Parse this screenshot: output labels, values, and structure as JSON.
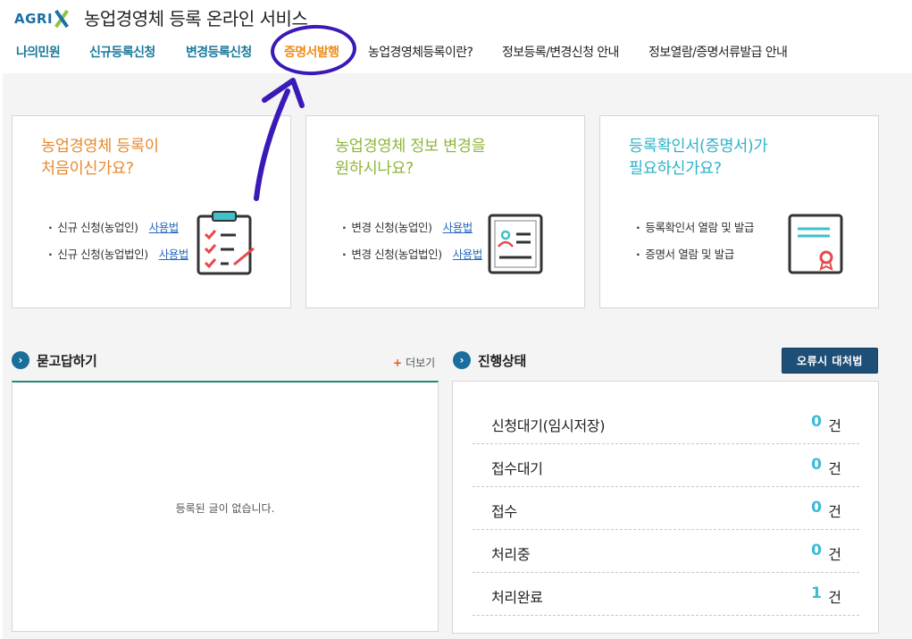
{
  "header": {
    "logo_text": "AGRI",
    "site_title": "농업경영체 등록 온라인 서비스"
  },
  "nav": {
    "items": [
      {
        "label": "나의민원"
      },
      {
        "label": "신규등록신청"
      },
      {
        "label": "변경등록신청"
      },
      {
        "label": "증명서발행"
      },
      {
        "label": "농업경영체등록이란?"
      },
      {
        "label": "정보등록/변경신청 안내"
      },
      {
        "label": "정보열람/증명서류발급 안내"
      }
    ]
  },
  "cards": [
    {
      "title_line1": "농업경영체 등록이",
      "title_line2": "처음이신가요?",
      "title_color": "#e8892c",
      "items": [
        {
          "text": "신규 신청(농업인)",
          "link": "사용법"
        },
        {
          "text": "신규 신청(농업법인)",
          "link": "사용법"
        }
      ],
      "icon": "clipboard-checklist-icon"
    },
    {
      "title_line1": "농업경영체 정보 변경을",
      "title_line2": "원하시나요?",
      "title_color": "#8fb63a",
      "items": [
        {
          "text": "변경 신청(농업인)",
          "link": "사용법"
        },
        {
          "text": "변경 신청(농업법인)",
          "link": "사용법"
        }
      ],
      "icon": "id-card-icon"
    },
    {
      "title_line1": "등록확인서(증명서)가",
      "title_line2": "필요하신가요?",
      "title_color": "#2ab3c8",
      "items": [
        {
          "text": "등록확인서 열람 및 발급"
        },
        {
          "text": "증명서 열람 및 발급"
        }
      ],
      "icon": "certificate-icon"
    }
  ],
  "qna": {
    "title": "묻고답하기",
    "more_label": "더보기",
    "empty_text": "등록된 글이 없습니다."
  },
  "status": {
    "title": "진행상태",
    "error_button": "오류시 대처법",
    "unit": "건",
    "rows": [
      {
        "label": "신청대기(임시저장)",
        "count": "0"
      },
      {
        "label": "접수대기",
        "count": "0"
      },
      {
        "label": "접수",
        "count": "0"
      },
      {
        "label": "처리중",
        "count": "0"
      },
      {
        "label": "처리완료",
        "count": "1"
      }
    ]
  },
  "colors": {
    "accent_teal": "#1a7a9c",
    "accent_orange": "#f08c1a",
    "annotation_purple": "#3a19b8",
    "status_count": "#3bb9d8",
    "button_navy": "#1e4f77"
  }
}
